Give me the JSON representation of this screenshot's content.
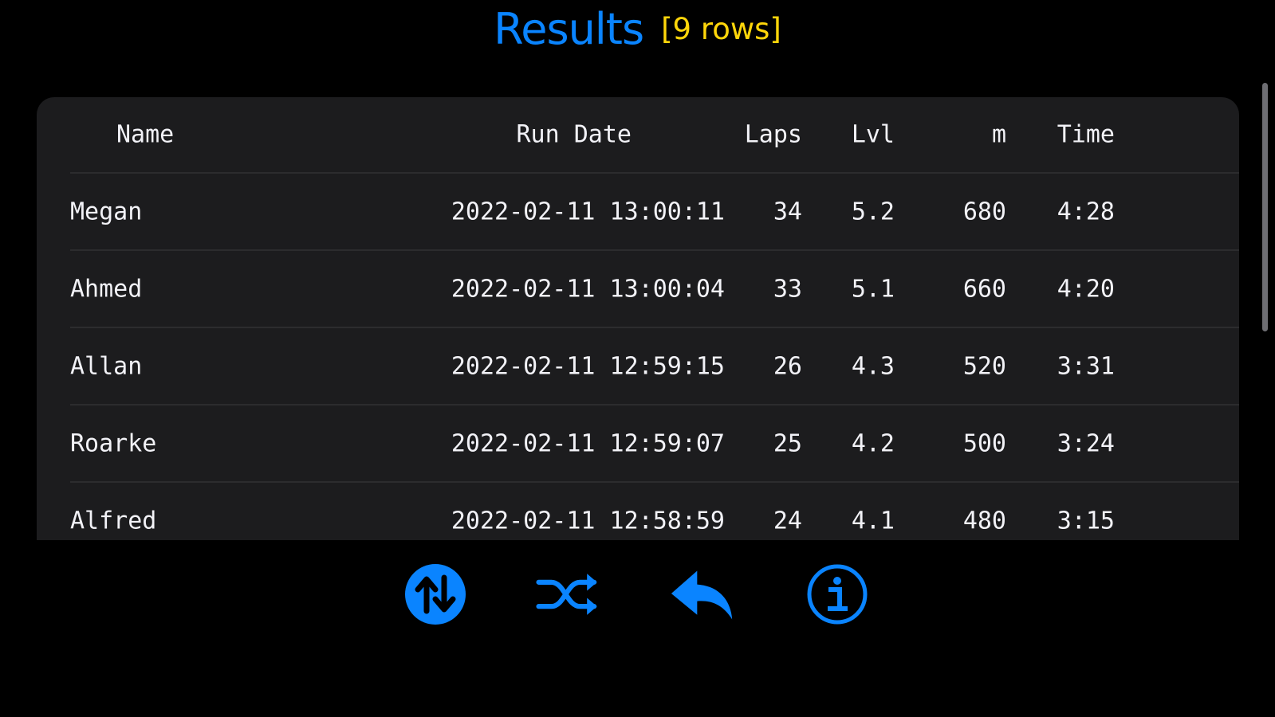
{
  "header": {
    "title": "Results",
    "row_count": "[9 rows]"
  },
  "table": {
    "columns": {
      "name": "Name",
      "run_date": "Run Date",
      "laps": "Laps",
      "lvl": "Lvl",
      "m": "m",
      "time": "Time"
    },
    "rows": [
      {
        "name": "Megan",
        "run_date": "2022-02-11 13:00:11",
        "laps": "34",
        "lvl": "5.2",
        "m": "680",
        "time": "4:28"
      },
      {
        "name": "Ahmed",
        "run_date": "2022-02-11 13:00:04",
        "laps": "33",
        "lvl": "5.1",
        "m": "660",
        "time": "4:20"
      },
      {
        "name": "Allan",
        "run_date": "2022-02-11 12:59:15",
        "laps": "26",
        "lvl": "4.3",
        "m": "520",
        "time": "3:31"
      },
      {
        "name": "Roarke",
        "run_date": "2022-02-11 12:59:07",
        "laps": "25",
        "lvl": "4.2",
        "m": "500",
        "time": "3:24"
      },
      {
        "name": "Alfred",
        "run_date": "2022-02-11 12:58:59",
        "laps": "24",
        "lvl": "4.1",
        "m": "480",
        "time": "3:15"
      }
    ]
  },
  "toolbar": {
    "buttons": [
      {
        "icon": "sort-icon"
      },
      {
        "icon": "shuffle-icon"
      },
      {
        "icon": "reply-icon"
      },
      {
        "icon": "info-icon"
      }
    ]
  },
  "colors": {
    "accent": "#0a84ff",
    "count": "#ffd60a",
    "background": "#000000",
    "panel": "#1c1c1e"
  }
}
